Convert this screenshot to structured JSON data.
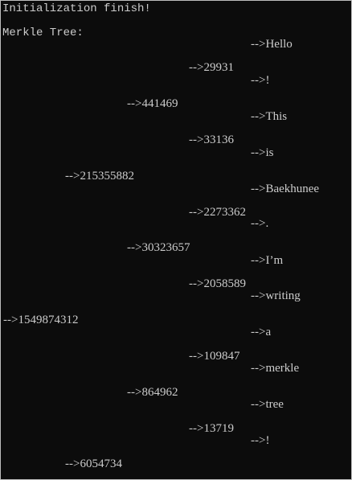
{
  "console": {
    "header": "Initialization finish!",
    "tree_title": "Merkle Tree:",
    "tree_lines": [
      "-->Hello",
      "-->29931",
      "-->!",
      "-->441469",
      "-->This",
      "-->33136",
      "-->is",
      "-->215355882",
      "-->Baekhunee",
      "-->2273362",
      "-->.",
      "-->30323657",
      "-->I’m",
      "-->2058589",
      "-->writing",
      "-->1549874312",
      "-->a",
      "-->109847",
      "-->merkle",
      "-->864962",
      "-->tree",
      "-->13719",
      "-->!",
      "-->6054734"
    ]
  }
}
